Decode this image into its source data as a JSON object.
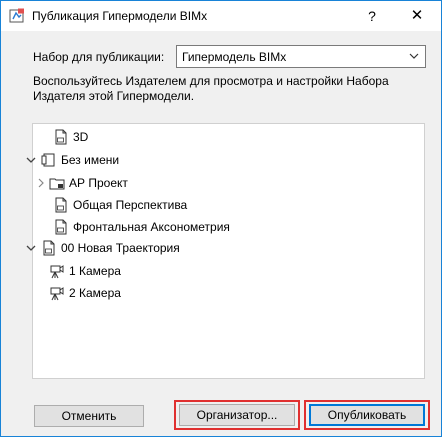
{
  "window": {
    "title": "Публикация Гипермодели BIMx",
    "help_label": "?",
    "close_label": "✕"
  },
  "publish_set": {
    "label": "Набор для публикации:",
    "selected": "Гипермодель BIMx"
  },
  "hint": "Воспользуйтесь Издателем для просмотра и настройки Набора Издателя этой Гипермодели.",
  "tree": {
    "items": [
      {
        "label": "3D",
        "icon": "document-icon",
        "expanded": null,
        "level": 0
      },
      {
        "label": "Без имени",
        "icon": "book-icon",
        "expanded": true,
        "level": 0
      },
      {
        "label": "АР Проект",
        "icon": "folder-icon",
        "expanded": false,
        "level": 1
      },
      {
        "label": "Общая Перспектива",
        "icon": "document-icon",
        "expanded": null,
        "level": 0
      },
      {
        "label": "Фронтальная Аксонометрия",
        "icon": "document-icon",
        "expanded": null,
        "level": 0
      },
      {
        "label": "00 Новая Траектория",
        "icon": "document-icon",
        "expanded": true,
        "level": 0
      },
      {
        "label": "1 Камера",
        "icon": "camera-icon",
        "expanded": null,
        "level": 1
      },
      {
        "label": "2 Камера",
        "icon": "camera-icon",
        "expanded": null,
        "level": 1
      }
    ]
  },
  "buttons": {
    "cancel": "Отменить",
    "organizer": "Организатор...",
    "publish": "Опубликовать"
  },
  "colors": {
    "accent": "#0078d7",
    "highlight": "#e03030"
  }
}
